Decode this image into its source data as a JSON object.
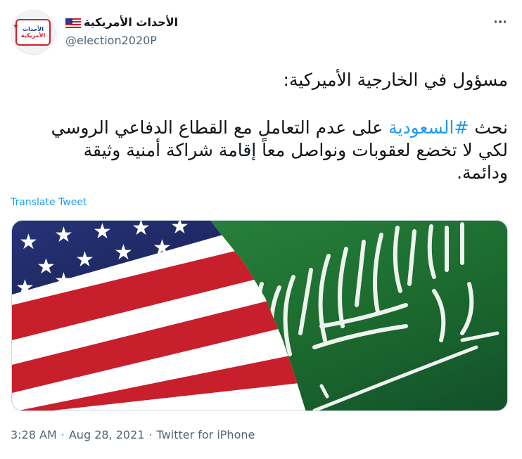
{
  "author": {
    "display_name": "الأحداث الأمريكية",
    "handle": "@election2020P",
    "name_emoji": "us-flag-icon",
    "avatar_text": [
      "الأحداث",
      "الأمريكية"
    ]
  },
  "tweet": {
    "heading": "مسؤول في الخارجية الأميركية:",
    "body_prefix": "نحث ",
    "hashtag": "#السعودية",
    "body_suffix": " على عدم التعامل مع القطاع الدفاعي الروسي لكي لا تخضع لعقوبات ونواصل معاً إقامة شراكة أمنية وثيقة ودائمة."
  },
  "translate_label": "Translate Tweet",
  "media": {
    "alt": "us-saudi-flags-image",
    "colors": {
      "us_red": "#c81f2c",
      "us_blue": "#1f2a6b",
      "saudi_green": "#1c6b2f"
    }
  },
  "meta": {
    "time": "3:28 AM",
    "date": "Aug 28, 2021",
    "source": "Twitter for iPhone",
    "separator": "·"
  },
  "colors": {
    "link": "#1d9bf0",
    "secondary": "#536471",
    "text": "#0f1419"
  }
}
